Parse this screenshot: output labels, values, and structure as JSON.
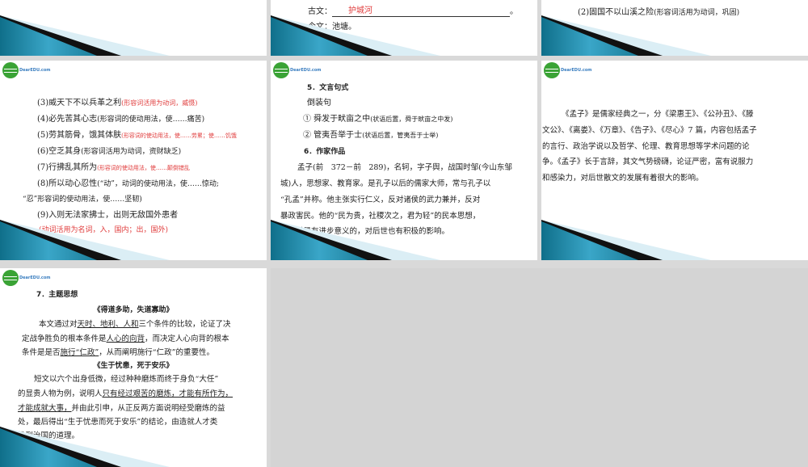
{
  "slides": {
    "r1c1": {
      "blank_label": "古文：",
      "blank_answer": "护城河",
      "blank_end": "。",
      "modern": "今文：池塘。"
    },
    "r1c2": {
      "line": "(2)固国不以山溪之险",
      "note": "(形容词活用为动词，巩固)"
    },
    "s1": {
      "lines": [
        {
          "t": "(3)威天下不以兵革之利",
          "n": "(形容词活用为动词，威慑)"
        },
        {
          "t": "(4)必先苦其心志",
          "n": "(形容词的使动用法，使……痛苦)"
        },
        {
          "t": "(5)劳其筋骨，饿其体肤",
          "n": "(形容词的使动用法，使……劳累；使……饥饿"
        },
        {
          "t": "(6)空乏其身",
          "n": "(形容词活用为动词，资财缺乏)"
        },
        {
          "t": "(7)行拂乱其所为",
          "n": "(形容词的使动用法，使……颠倒错乱"
        },
        {
          "t": "(8)所以动心忍性",
          "n": "(“动”，动词的使动用法，使……惊动;"
        },
        {
          "t": "“忍”形容词的使动用法，使……坚韧)"
        },
        {
          "t": "(9)入则无法家拂士，出则无敌国外患者"
        },
        {
          "n": "(动词活用为名词，入，国内；出，国外)"
        }
      ]
    },
    "s2": {
      "h5": "5．文言句式",
      "sub": "倒装句",
      "l1": "① 舜发于畎亩之中",
      "n1": "(状语后置，舜于畎亩之中发)",
      "l2": "② 管夷吾举于士",
      "n2": "(状语后置，管夷吾于士举)",
      "h6": "6．作家作品",
      "para": [
        "孟子(前　372－前　289)，名轲，字子舆，战国时邹(今山东邹",
        "城)人，思想家、教育家。是孔子以后的儒家大师，常与孔子以",
        "“孔孟”并称。他主张实行仁义，反对诸侯的武力兼并，反对",
        "暴政害民。他的“民为贵，社稷次之，君为轻”的民本思想，",
        "在当时是有进步意义的，对后世也有积极的影响。"
      ]
    },
    "s3": {
      "para": [
        "《孟子》是儒家经典之一，分《梁惠王》、《公孙丑》、《滕",
        "文公》、《离娄》、《万章》、《告子》、《尽心》7 篇，内容包括孟子",
        "的言行、政治学说以及哲学、伦理、教育思想等学术问题的论",
        "争。《孟子》长于言辞，其文气势磅礴，论证严密，富有说服力",
        "和感染力，对后世散文的发展有着很大的影响。"
      ]
    },
    "s4": {
      "h7": "7．主题思想",
      "title1": "《得道多助，失道寡助》",
      "p1": {
        "a": "本文通过对",
        "u1": "天时、地利、人和",
        "b": "三个条件的比较，论证了决",
        "c": "定战争胜负的根本条件是",
        "u2": "人心的向背",
        "d": "，而决定人心向背的根本",
        "e": "条件是是否",
        "u3": "施行“仁政”",
        "f": "，从而阐明施行“仁政”的重要性。"
      },
      "title2": "《生于忧患，死于安乐》",
      "p2": {
        "a": "短文以六个出身低微，经过种种磨炼而终于身负“大任”",
        "b": "的显贵人物为例，说明人",
        "u1": "只有经过艰苦的磨炼，才能有所作为，",
        "u2": "才能成就大事，",
        "c": "并由此引申，从正反两方面说明经受磨炼的益",
        "d": "处，最后得出“生于忧患而死于安乐”的结论，由造就人才类",
        "e": "推到治国的道理。"
      }
    }
  },
  "logo": "DearEDU.com"
}
